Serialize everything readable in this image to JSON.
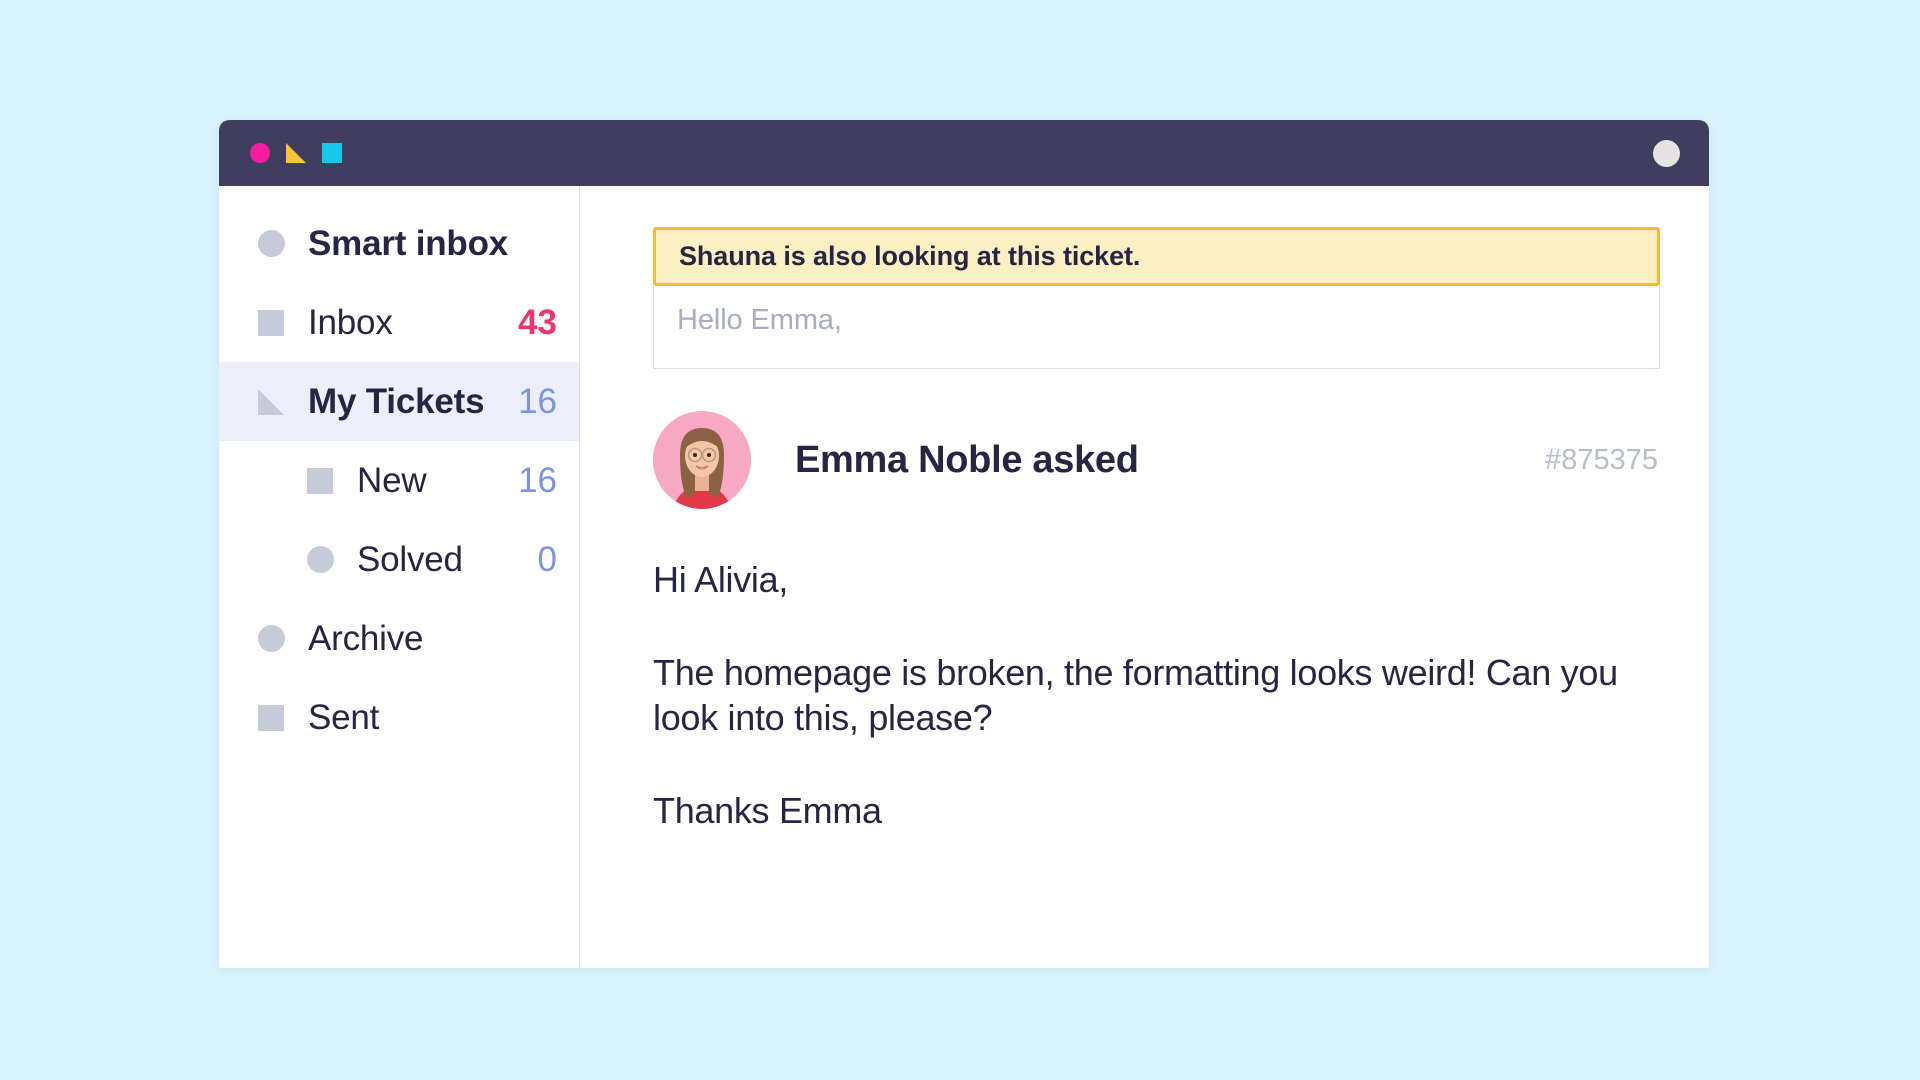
{
  "window": {
    "titlebar": {
      "controls": [
        {
          "icon": "circle-icon",
          "color": "#f81ca0"
        },
        {
          "icon": "triangle-icon",
          "color": "#fbc33a"
        },
        {
          "icon": "square-icon",
          "color": "#15c8e8"
        }
      ],
      "user_avatar_icon": "user-avatar-icon"
    }
  },
  "sidebar": {
    "items": [
      {
        "label": "Smart inbox",
        "icon": "circle-icon",
        "count": "",
        "bold": true,
        "child": false,
        "active": false,
        "count_color": ""
      },
      {
        "label": "Inbox",
        "icon": "square-icon",
        "count": "43",
        "bold": false,
        "child": false,
        "active": false,
        "count_color": "#f0356e"
      },
      {
        "label": "My Tickets",
        "icon": "triangle-icon",
        "count": "16",
        "bold": true,
        "child": false,
        "active": true,
        "count_color": "#7b93e0"
      },
      {
        "label": "New",
        "icon": "square-icon",
        "count": "16",
        "bold": false,
        "child": true,
        "active": false,
        "count_color": "#7b93e0"
      },
      {
        "label": "Solved",
        "icon": "circle-icon",
        "count": "0",
        "bold": false,
        "child": true,
        "active": false,
        "count_color": "#7b93e0"
      },
      {
        "label": "Archive",
        "icon": "circle-icon",
        "count": "",
        "bold": false,
        "child": false,
        "active": false,
        "count_color": ""
      },
      {
        "label": "Sent",
        "icon": "square-icon",
        "count": "",
        "bold": false,
        "child": false,
        "active": false,
        "count_color": ""
      }
    ]
  },
  "content": {
    "alert": {
      "text": "Shauna is also looking at this ticket."
    },
    "reply": {
      "placeholder": "Hello Emma,",
      "value": ""
    },
    "ticket": {
      "asker": "Emma Noble asked",
      "id": "#875375",
      "avatar_icon": "user-photo-avatar",
      "body": [
        "Hi Alivia,",
        "The homepage is broken, the formatting looks weird! Can you look into this, please?",
        "Thanks Emma"
      ]
    }
  },
  "colors": {
    "page_background": "#d7f3fd",
    "titlebar": "#3f3e5f",
    "text_primary": "#262544",
    "accent_pink": "#f0356e",
    "accent_blue": "#7b93e0",
    "alert_border": "#f6bb34",
    "alert_background": "#fcefc2",
    "active_row": "#eceefa",
    "icon_gray": "#c6cbd9"
  }
}
